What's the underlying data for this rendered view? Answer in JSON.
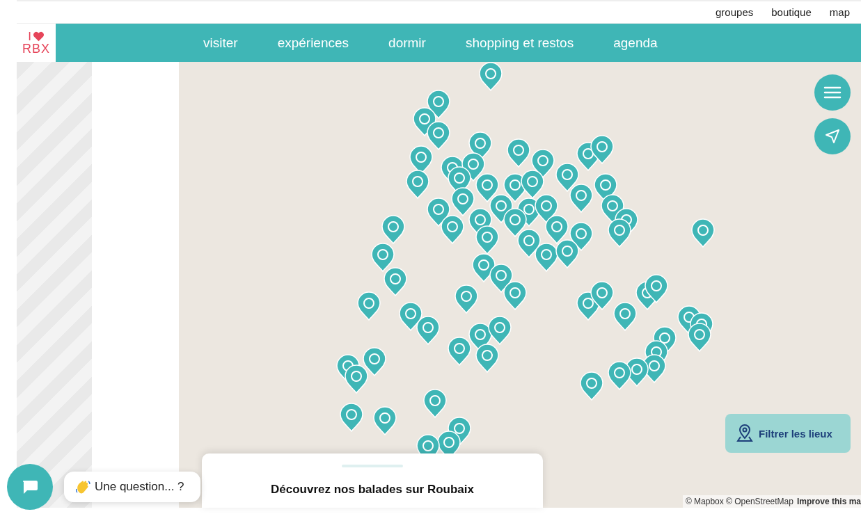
{
  "top_links": [
    "groupes",
    "boutique",
    "map"
  ],
  "logo": {
    "top": "I",
    "bottom": "RBX"
  },
  "nav": [
    "visiter",
    "expériences",
    "dormir",
    "shopping et restos",
    "agenda"
  ],
  "map": {
    "filter_button": "Filtrer les lieux",
    "attribution": "© Mapbox © OpenStreetMap",
    "improve_link": "Improve this ma"
  },
  "card": {
    "title": "Découvrez nos balades sur Roubaix"
  },
  "chat": {
    "bubble": "Une question... ?"
  }
}
